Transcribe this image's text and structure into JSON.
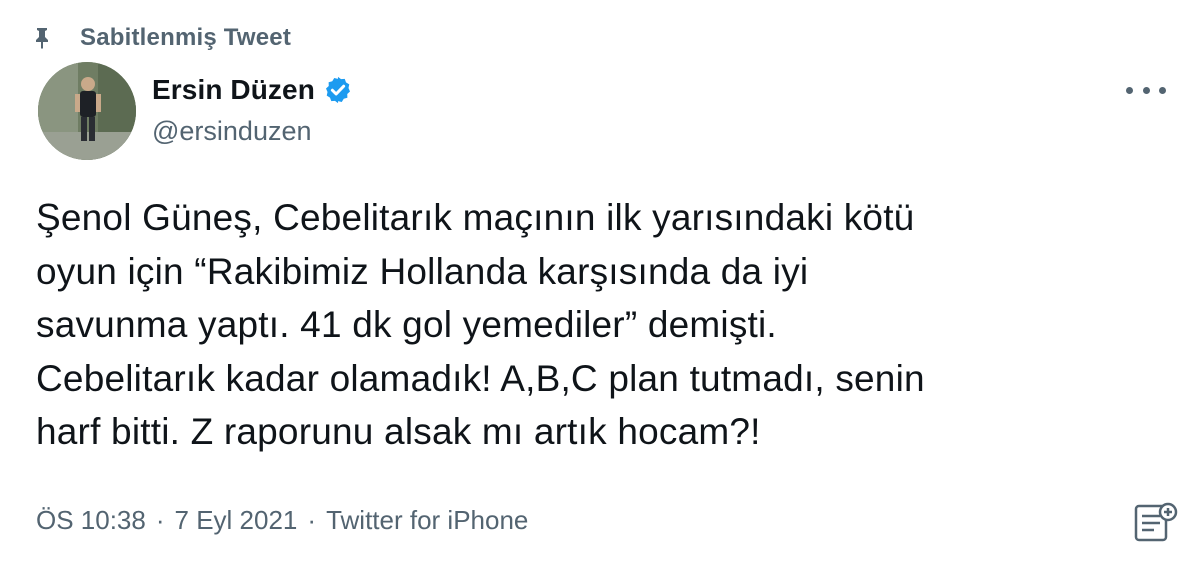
{
  "pinned": {
    "icon": "pin-icon",
    "label": "Sabitlenmiş Tweet"
  },
  "author": {
    "avatar_icon": "avatar",
    "display_name": "Ersin Düzen",
    "verified_icon": "verified-badge-icon",
    "handle": "@ersinduzen"
  },
  "menu": {
    "icon": "more-options-icon"
  },
  "tweet": {
    "text": "Şenol Güneş, Cebelitarık maçının ilk yarısındaki kötü\noyun için “Rakibimiz Hollanda karşısında da iyi\nsavunma yaptı. 41 dk gol yemediler” demişti.\nCebelitarık kadar olamadık! A,B,C plan tutmadı, senin\nharf bitti. Z raporunu alsak mı artık hocam?!"
  },
  "meta": {
    "time": "ÖS 10:38",
    "separator_1": "·",
    "date": "7 Eyl 2021",
    "separator_2": "·",
    "source": "Twitter for iPhone"
  },
  "analytics": {
    "icon": "analytics-icon"
  },
  "colors": {
    "text_primary": "#0f1419",
    "text_secondary": "#536471",
    "verified_blue": "#1d9bf0",
    "background": "#ffffff"
  }
}
